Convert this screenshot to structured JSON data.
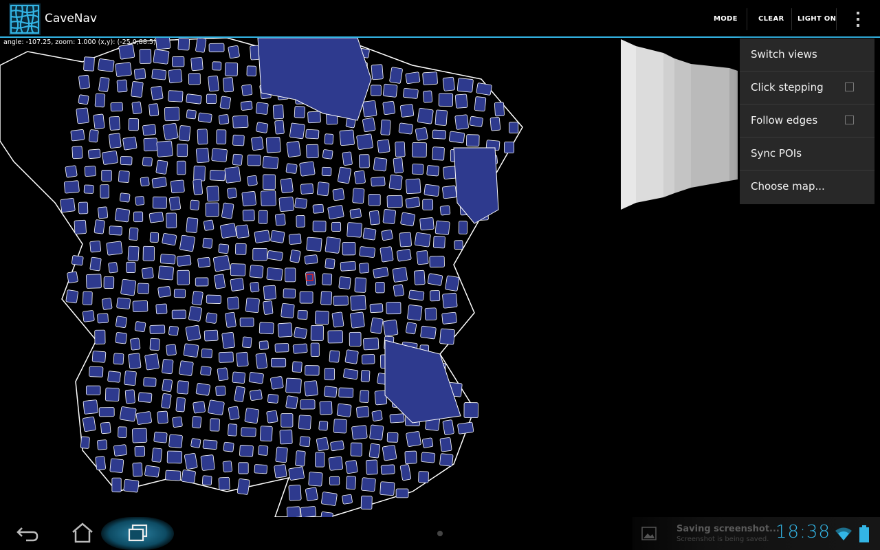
{
  "app": {
    "title": "CaveNav",
    "icon": "grid-map-icon"
  },
  "action_bar": {
    "mode_label": "MODE",
    "clear_label": "CLEAR",
    "light_label": "LIGHT ON",
    "overflow_icon": "overflow-menu-icon",
    "accent_color": "#33b5e5"
  },
  "map": {
    "debug_text": "angle: -107.25, zoom: 1.000 (x,y): (-25.0,88.5)",
    "water_color": "#2e3a8e",
    "passage_color": "#000000",
    "wall_color": "#ffffff",
    "position_marker": "current-position-marker"
  },
  "menu": {
    "items": [
      {
        "label": "Switch views",
        "checkbox": false
      },
      {
        "label": "Click stepping",
        "checkbox": true,
        "checked": false
      },
      {
        "label": "Follow edges",
        "checkbox": true,
        "checked": false
      },
      {
        "label": "Sync POIs",
        "checkbox": false
      },
      {
        "label": "Choose map...",
        "checkbox": false
      }
    ]
  },
  "system_bar": {
    "back_icon": "back-icon",
    "home_icon": "home-icon",
    "recents_icon": "recent-apps-icon",
    "notification_title": "Saving screenshot...",
    "notification_subtitle": "Screenshot is being saved.",
    "clock": "18:38",
    "wifi_icon": "wifi-icon",
    "battery_icon": "battery-icon"
  }
}
